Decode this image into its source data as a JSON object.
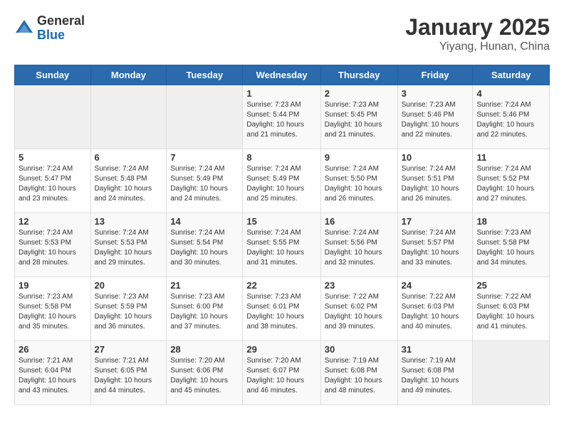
{
  "header": {
    "logo_general": "General",
    "logo_blue": "Blue",
    "title": "January 2025",
    "subtitle": "Yiyang, Hunan, China"
  },
  "days_of_week": [
    "Sunday",
    "Monday",
    "Tuesday",
    "Wednesday",
    "Thursday",
    "Friday",
    "Saturday"
  ],
  "weeks": [
    [
      {
        "day": "",
        "sunrise": "",
        "sunset": "",
        "daylight": ""
      },
      {
        "day": "",
        "sunrise": "",
        "sunset": "",
        "daylight": ""
      },
      {
        "day": "",
        "sunrise": "",
        "sunset": "",
        "daylight": ""
      },
      {
        "day": "1",
        "sunrise": "Sunrise: 7:23 AM",
        "sunset": "Sunset: 5:44 PM",
        "daylight": "Daylight: 10 hours and 21 minutes."
      },
      {
        "day": "2",
        "sunrise": "Sunrise: 7:23 AM",
        "sunset": "Sunset: 5:45 PM",
        "daylight": "Daylight: 10 hours and 21 minutes."
      },
      {
        "day": "3",
        "sunrise": "Sunrise: 7:23 AM",
        "sunset": "Sunset: 5:46 PM",
        "daylight": "Daylight: 10 hours and 22 minutes."
      },
      {
        "day": "4",
        "sunrise": "Sunrise: 7:24 AM",
        "sunset": "Sunset: 5:46 PM",
        "daylight": "Daylight: 10 hours and 22 minutes."
      }
    ],
    [
      {
        "day": "5",
        "sunrise": "Sunrise: 7:24 AM",
        "sunset": "Sunset: 5:47 PM",
        "daylight": "Daylight: 10 hours and 23 minutes."
      },
      {
        "day": "6",
        "sunrise": "Sunrise: 7:24 AM",
        "sunset": "Sunset: 5:48 PM",
        "daylight": "Daylight: 10 hours and 24 minutes."
      },
      {
        "day": "7",
        "sunrise": "Sunrise: 7:24 AM",
        "sunset": "Sunset: 5:49 PM",
        "daylight": "Daylight: 10 hours and 24 minutes."
      },
      {
        "day": "8",
        "sunrise": "Sunrise: 7:24 AM",
        "sunset": "Sunset: 5:49 PM",
        "daylight": "Daylight: 10 hours and 25 minutes."
      },
      {
        "day": "9",
        "sunrise": "Sunrise: 7:24 AM",
        "sunset": "Sunset: 5:50 PM",
        "daylight": "Daylight: 10 hours and 26 minutes."
      },
      {
        "day": "10",
        "sunrise": "Sunrise: 7:24 AM",
        "sunset": "Sunset: 5:51 PM",
        "daylight": "Daylight: 10 hours and 26 minutes."
      },
      {
        "day": "11",
        "sunrise": "Sunrise: 7:24 AM",
        "sunset": "Sunset: 5:52 PM",
        "daylight": "Daylight: 10 hours and 27 minutes."
      }
    ],
    [
      {
        "day": "12",
        "sunrise": "Sunrise: 7:24 AM",
        "sunset": "Sunset: 5:53 PM",
        "daylight": "Daylight: 10 hours and 28 minutes."
      },
      {
        "day": "13",
        "sunrise": "Sunrise: 7:24 AM",
        "sunset": "Sunset: 5:53 PM",
        "daylight": "Daylight: 10 hours and 29 minutes."
      },
      {
        "day": "14",
        "sunrise": "Sunrise: 7:24 AM",
        "sunset": "Sunset: 5:54 PM",
        "daylight": "Daylight: 10 hours and 30 minutes."
      },
      {
        "day": "15",
        "sunrise": "Sunrise: 7:24 AM",
        "sunset": "Sunset: 5:55 PM",
        "daylight": "Daylight: 10 hours and 31 minutes."
      },
      {
        "day": "16",
        "sunrise": "Sunrise: 7:24 AM",
        "sunset": "Sunset: 5:56 PM",
        "daylight": "Daylight: 10 hours and 32 minutes."
      },
      {
        "day": "17",
        "sunrise": "Sunrise: 7:24 AM",
        "sunset": "Sunset: 5:57 PM",
        "daylight": "Daylight: 10 hours and 33 minutes."
      },
      {
        "day": "18",
        "sunrise": "Sunrise: 7:23 AM",
        "sunset": "Sunset: 5:58 PM",
        "daylight": "Daylight: 10 hours and 34 minutes."
      }
    ],
    [
      {
        "day": "19",
        "sunrise": "Sunrise: 7:23 AM",
        "sunset": "Sunset: 5:58 PM",
        "daylight": "Daylight: 10 hours and 35 minutes."
      },
      {
        "day": "20",
        "sunrise": "Sunrise: 7:23 AM",
        "sunset": "Sunset: 5:59 PM",
        "daylight": "Daylight: 10 hours and 36 minutes."
      },
      {
        "day": "21",
        "sunrise": "Sunrise: 7:23 AM",
        "sunset": "Sunset: 6:00 PM",
        "daylight": "Daylight: 10 hours and 37 minutes."
      },
      {
        "day": "22",
        "sunrise": "Sunrise: 7:23 AM",
        "sunset": "Sunset: 6:01 PM",
        "daylight": "Daylight: 10 hours and 38 minutes."
      },
      {
        "day": "23",
        "sunrise": "Sunrise: 7:22 AM",
        "sunset": "Sunset: 6:02 PM",
        "daylight": "Daylight: 10 hours and 39 minutes."
      },
      {
        "day": "24",
        "sunrise": "Sunrise: 7:22 AM",
        "sunset": "Sunset: 6:03 PM",
        "daylight": "Daylight: 10 hours and 40 minutes."
      },
      {
        "day": "25",
        "sunrise": "Sunrise: 7:22 AM",
        "sunset": "Sunset: 6:03 PM",
        "daylight": "Daylight: 10 hours and 41 minutes."
      }
    ],
    [
      {
        "day": "26",
        "sunrise": "Sunrise: 7:21 AM",
        "sunset": "Sunset: 6:04 PM",
        "daylight": "Daylight: 10 hours and 43 minutes."
      },
      {
        "day": "27",
        "sunrise": "Sunrise: 7:21 AM",
        "sunset": "Sunset: 6:05 PM",
        "daylight": "Daylight: 10 hours and 44 minutes."
      },
      {
        "day": "28",
        "sunrise": "Sunrise: 7:20 AM",
        "sunset": "Sunset: 6:06 PM",
        "daylight": "Daylight: 10 hours and 45 minutes."
      },
      {
        "day": "29",
        "sunrise": "Sunrise: 7:20 AM",
        "sunset": "Sunset: 6:07 PM",
        "daylight": "Daylight: 10 hours and 46 minutes."
      },
      {
        "day": "30",
        "sunrise": "Sunrise: 7:19 AM",
        "sunset": "Sunset: 6:08 PM",
        "daylight": "Daylight: 10 hours and 48 minutes."
      },
      {
        "day": "31",
        "sunrise": "Sunrise: 7:19 AM",
        "sunset": "Sunset: 6:08 PM",
        "daylight": "Daylight: 10 hours and 49 minutes."
      },
      {
        "day": "",
        "sunrise": "",
        "sunset": "",
        "daylight": ""
      }
    ]
  ]
}
